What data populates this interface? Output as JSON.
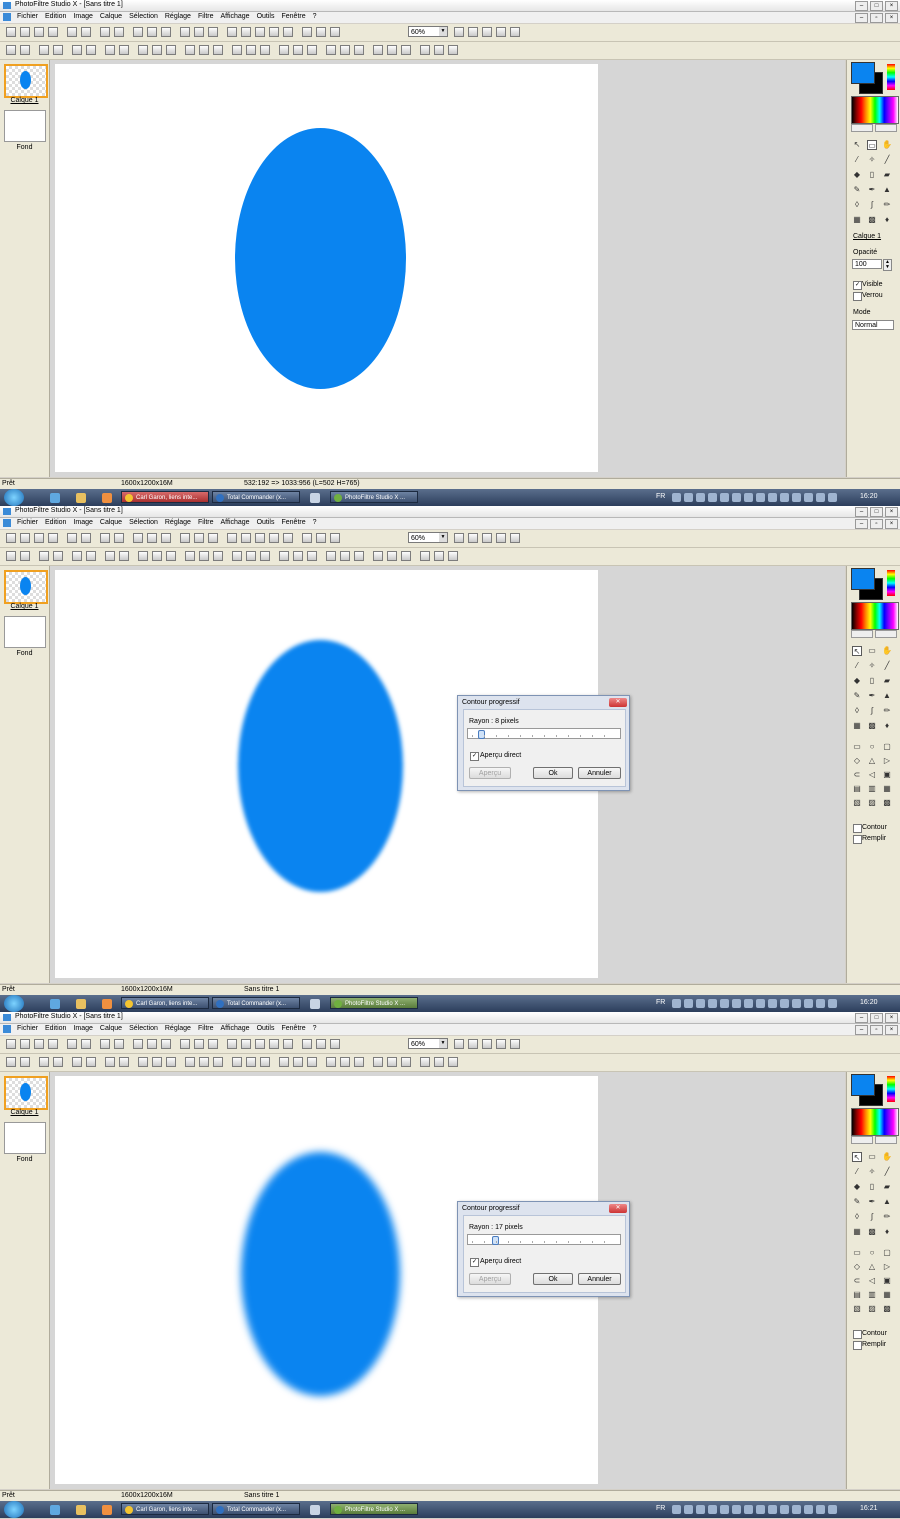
{
  "app": {
    "window_title": "PhotoFiltre Studio X - [Sans titre 1]",
    "zoom": "60%",
    "menu": [
      "Fichier",
      "Edition",
      "Image",
      "Calque",
      "Sélection",
      "Réglage",
      "Filtre",
      "Affichage",
      "Outils",
      "Fenêtre",
      "?"
    ],
    "layers": {
      "calque": "Calque 1",
      "fond": "Fond"
    }
  },
  "properties": {
    "calque_link": "Calque 1",
    "opacity_label": "Opacité",
    "opacity_value": "100",
    "visible_label": "Visible",
    "lock_label": "Verrou",
    "mode_label": "Mode",
    "mode_value": "Normal"
  },
  "shape_options": {
    "contour_label": "Contour",
    "remplir_label": "Remplir"
  },
  "status": {
    "ready": "Prêt",
    "size": "1600x1200x16M",
    "panel1_info": "532:192 => 1033:956 (L=502  H=765)",
    "panel2_info": "Sans titre 1",
    "panel3_info": "Sans titre 1"
  },
  "taskbar": {
    "items": [
      "Carl Garon, liens inte...",
      "Total Commander (x...",
      "PhotoFiltre Studio X ..."
    ],
    "lang": "FR",
    "times": [
      "16:20",
      "16:20",
      "16:21"
    ]
  },
  "dialog": {
    "title": "Contour progressif",
    "rayon_panel2": "Rayon : 8 pixels",
    "rayon_panel3": "Rayon : 17 pixels",
    "apercu_direct": "Aperçu direct",
    "apercu_button": "Aperçu",
    "ok_button": "Ok",
    "annuler_button": "Annuler"
  },
  "colors": {
    "foreground": "#0a84f0",
    "background": "#000000",
    "ellipse": "#0a84f0"
  },
  "icons": {
    "close": "close-icon",
    "minimize": "minimize-icon",
    "maximize": "maximize-icon",
    "checkmark": "✓"
  }
}
